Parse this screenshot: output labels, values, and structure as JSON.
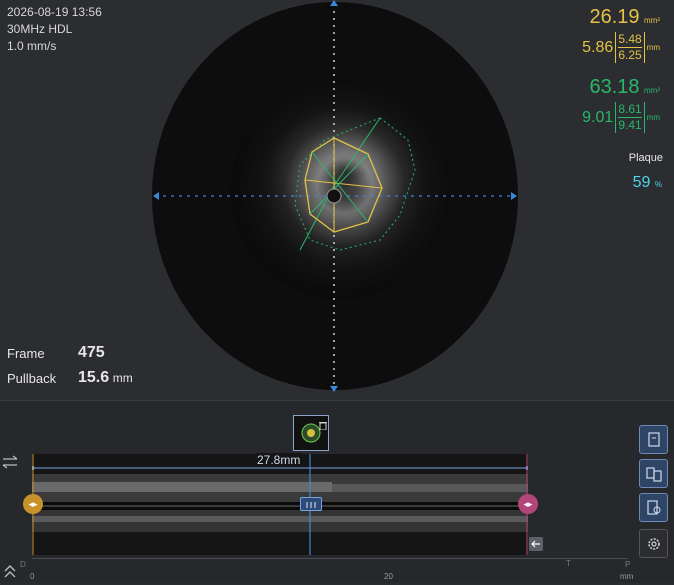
{
  "header": {
    "datetime": "2026-08-19 13:56",
    "probe": "30MHz HDL",
    "speed": "1.0 mm/s"
  },
  "measurements": {
    "lumen": {
      "area": "26.19",
      "area_unit": "mm²",
      "min_diam": "5.86",
      "diam_a": "5.48",
      "diam_b": "6.25",
      "diam_unit": "mm",
      "color": "#e3c247"
    },
    "vessel": {
      "area": "63.18",
      "area_unit": "mm²",
      "min_diam": "9.01",
      "diam_a": "8.61",
      "diam_b": "9.41",
      "diam_unit": "mm",
      "color": "#27b86a"
    },
    "plaque": {
      "label": "Plaque",
      "value": "59",
      "unit": "%",
      "color": "#4fd3ea"
    }
  },
  "frame": {
    "label": "Frame",
    "value": "475"
  },
  "pullback": {
    "label": "Pullback",
    "value": "15.6",
    "unit": "mm"
  },
  "longview": {
    "length_label": "27.8mm",
    "axis": {
      "left": "D",
      "start": "0",
      "mid": "20",
      "unit": "mm",
      "t": "T",
      "p": "P"
    }
  },
  "icons": {
    "swap": "swap-arrows-icon",
    "expand": "double-chevron-up-icon",
    "ref": "ref-report-icon",
    "compare": "compare-frames-icon",
    "bookmark": "location-bookmark-icon",
    "settings": "gear-icon",
    "back": "back-arrow-icon",
    "delete": "trash-icon"
  },
  "colors": {
    "accent": "#3d6fb5",
    "bg": "#2b2d31",
    "left_handle": "#c8922b",
    "right_handle": "#b4457a"
  }
}
